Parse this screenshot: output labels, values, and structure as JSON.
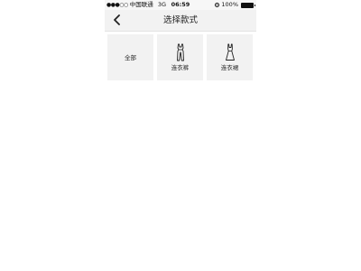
{
  "status_bar": {
    "signal": "●●●○○",
    "carrier": "中国联通",
    "network": "3G",
    "time": "06:59",
    "battery": "100%",
    "icons": [
      "signal-dots-icon",
      "orientation-lock-icon",
      "battery-icon"
    ]
  },
  "nav": {
    "back_icon": "chevron-left-icon",
    "title": "选择款式"
  },
  "styles": [
    {
      "label": "全部",
      "icon": null
    },
    {
      "label": "连衣裤",
      "icon": "jumpsuit-icon"
    },
    {
      "label": "连衣裙",
      "icon": "dress-icon"
    }
  ]
}
